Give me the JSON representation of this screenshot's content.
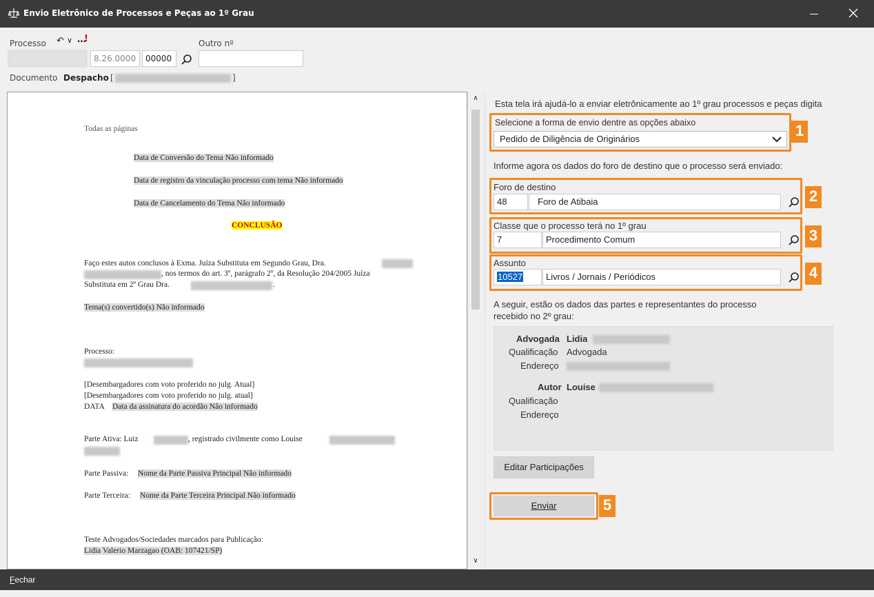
{
  "window": {
    "title": "Envio Eletrônico de Processos e Peças ao 1º Grau",
    "icons": {
      "app": "scales-icon",
      "minimize": "minimize-icon",
      "close": "close-icon"
    }
  },
  "header": {
    "processo_label": "Processo",
    "processo_tools": {
      "back": "↶",
      "chevron": "∨",
      "more": "…",
      "alert": "!"
    },
    "outro_label": "Outro nº",
    "processo_field2": "8.26.0000",
    "processo_field3": "00000",
    "outro_value": "",
    "documento_label": "Documento",
    "documento_value": "Despacho",
    "documento_bracket_open": "[",
    "documento_bracket_close": "]"
  },
  "document": {
    "lines": {
      "todas": "Todas as páginas",
      "conversao": "Data de Conversão do Tema Não informado",
      "registro": "Data de registro da vinculação processo com tema Não informado",
      "cancelamento": "Data de Cancelamento do Tema Não informado",
      "conclusao": "CONCLUSÃO",
      "faco1": "Faço estes autos conclusos à Exma. Juíza Substituta em Segundo Grau, Dra.",
      "faco2": ", nos termos do art. 3º, parágrafo 2º, da Resolução 204/2005 Juíza",
      "faco3a": "Substituta em 2º Grau Dra.",
      "faco3b": ".",
      "tema": "Tema(s) convertido(s) Não informado",
      "processo": "Processo:",
      "des1": "[Desembargadores com voto proferido no julg. Atual]",
      "des2": "[Desembargadores com voto proferido no julg. atual]",
      "data_prefix": "DATA",
      "data_rest": "Data da assinatura do acordão Não informado",
      "ativa_prefix": "Parte Ativa: Luiz",
      "ativa_rest": ", registrado civilmente como Louise",
      "passiva_prefix": "Parte Passiva:",
      "passiva_rest": "Nome da Parte Passiva Principal Não informado",
      "terceira_prefix": "Parte Terceira:",
      "terceira_rest": "Nome da Parte Terceira Principal Não informado",
      "teste": "Teste Advogados/Sociedades marcados para Publicação:",
      "lidia": "Lidia Valerio Marzagao (OAB: 107421/SP)"
    }
  },
  "right": {
    "intro": "Esta tela irá ajudá-lo a enviar eletrônicamente ao 1º grau processos e peças digita",
    "forma": {
      "label": "Selecione a forma de envio dentre as opções abaixo",
      "selected": "Pedido de Diligência de Originários",
      "badge": "1"
    },
    "informe": "Informe agora os dados do foro de destino que o processo será enviado:",
    "foro": {
      "label": "Foro de destino",
      "code": "48",
      "name": "Foro de Atibaia",
      "badge": "2"
    },
    "classe": {
      "label": "Classe que o processo terá no 1º grau",
      "code": "7",
      "name": "Procedimento Comum",
      "badge": "3"
    },
    "assunto": {
      "label": "Assunto",
      "code": "10527",
      "name": "Livros / Jornais / Periódicos",
      "badge": "4"
    },
    "seguir": "A seguir, estão os dados das partes e representantes do processo",
    "seguir2": "recebido no 2º grau:",
    "partes": {
      "p1_role": "Advogada",
      "p1_name": "Lidia",
      "p1_qual_label": "Qualificação",
      "p1_qual_value": "Advogada",
      "p1_end_label": "Endereço",
      "p2_role": "Autor",
      "p2_name": "Louise",
      "p2_qual_label": "Qualificação",
      "p2_end_label": "Endereço"
    },
    "editar_button": "Editar Participações",
    "enviar_button": "Enviar",
    "enviar_badge": "5"
  },
  "footer": {
    "fechar_first": "F",
    "fechar_rest": "echar"
  },
  "colors": {
    "accent": "#f08a24",
    "titlebar": "#3a3a3a",
    "highlight": "#ffff00"
  }
}
